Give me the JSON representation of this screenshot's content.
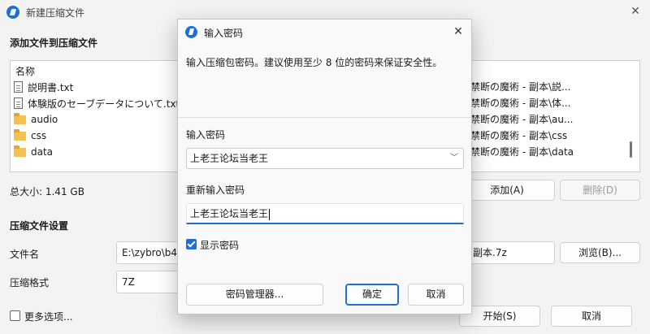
{
  "background": {
    "title": "新建压缩文件",
    "section_files": "添加文件到压缩文件",
    "column_name": "名称",
    "files": [
      {
        "name": "説明書.txt",
        "type": "file"
      },
      {
        "name": "体験版のセーブデータについて.txt",
        "type": "file"
      },
      {
        "name": "audio",
        "type": "folder"
      },
      {
        "name": "css",
        "type": "folder"
      },
      {
        "name": "data",
        "type": "folder"
      }
    ],
    "paths": [
      "禁断の魔術 - 副本\\説...",
      "禁断の魔術 - 副本\\体...",
      "禁断の魔術 - 副本\\au...",
      "禁断の魔術 - 副本\\css",
      "禁断の魔術 - 副本\\data"
    ],
    "total_size": "总大小: 1.41 GB",
    "add_button": "添加(A)",
    "delete_button": "删除(D)",
    "section_settings": "压缩文件设置",
    "filename_label": "文件名",
    "filename_value_left": "E:\\zybro\\b4l",
    "filename_value_right": "副本.7z",
    "browse_button": "浏览(B)...",
    "format_label": "压缩格式",
    "format_value": "7Z",
    "more_options": "更多选项...",
    "start_button": "开始(S)",
    "cancel_button": "取消"
  },
  "dialog": {
    "title": "输入密码",
    "description": "输入压缩包密码。建议使用至少 8 位的密码来保证安全性。",
    "password_label": "输入密码",
    "password_value": "上老王论坛当老王",
    "repeat_label": "重新输入密码",
    "repeat_value": "上老王论坛当老王",
    "show_password_label": "显示密码",
    "show_password_checked": true,
    "manager_button": "密码管理器...",
    "ok_button": "确定",
    "cancel_button": "取消"
  },
  "colors": {
    "accent": "#1f6fd1",
    "folder": "#f2c14e"
  }
}
